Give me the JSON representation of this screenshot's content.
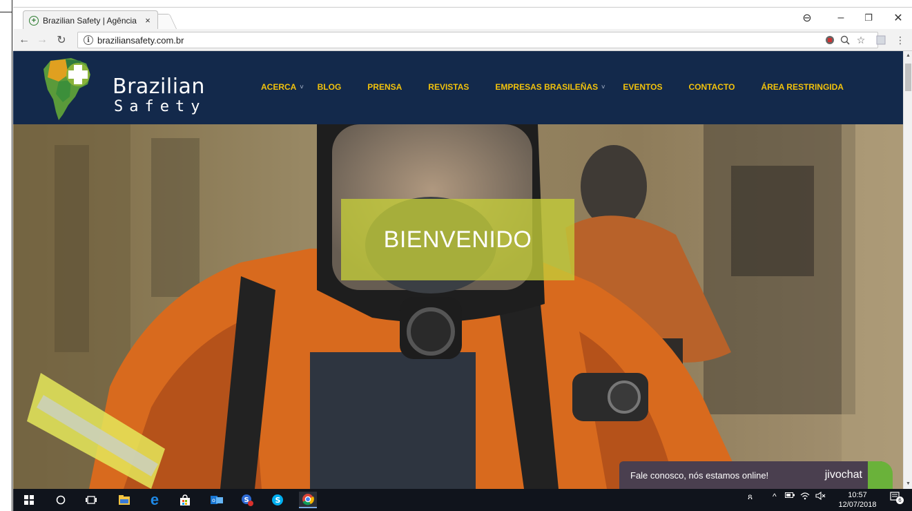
{
  "browser": {
    "tab_title": "Brazilian Safety | Agência",
    "tab_close": "×",
    "url": "braziliansafety.com.br",
    "window_controls": {
      "account": "⊖",
      "minimize": "–",
      "restore": "❐",
      "close": "✕"
    }
  },
  "site": {
    "logo_line1": "Brazilian",
    "logo_line2": "Safety",
    "menu": [
      {
        "label": "ACERCA",
        "caret": "˅"
      },
      {
        "label": "BLOG"
      },
      {
        "label": "PRENSA"
      },
      {
        "label": "REVISTAS"
      },
      {
        "label": "EMPRESAS BRASILEÑAS",
        "caret": "˅"
      },
      {
        "label": "EVENTOS"
      },
      {
        "label": "CONTACTO"
      },
      {
        "label": "ÁREA RESTRINGIDA"
      }
    ],
    "hero_title": "BIENVENIDO",
    "chat_message": "Fale conosco, nós estamos online!",
    "chat_brand": "jivochat"
  },
  "taskbar": {
    "time": "10:57",
    "date": "12/07/2018",
    "notifications_badge": "6"
  },
  "colors": {
    "nav_bg": "#13294b",
    "menu_text": "#f2c20c",
    "welcome_box": "#c4cd39",
    "chat_bg": "#4a3f4f"
  }
}
